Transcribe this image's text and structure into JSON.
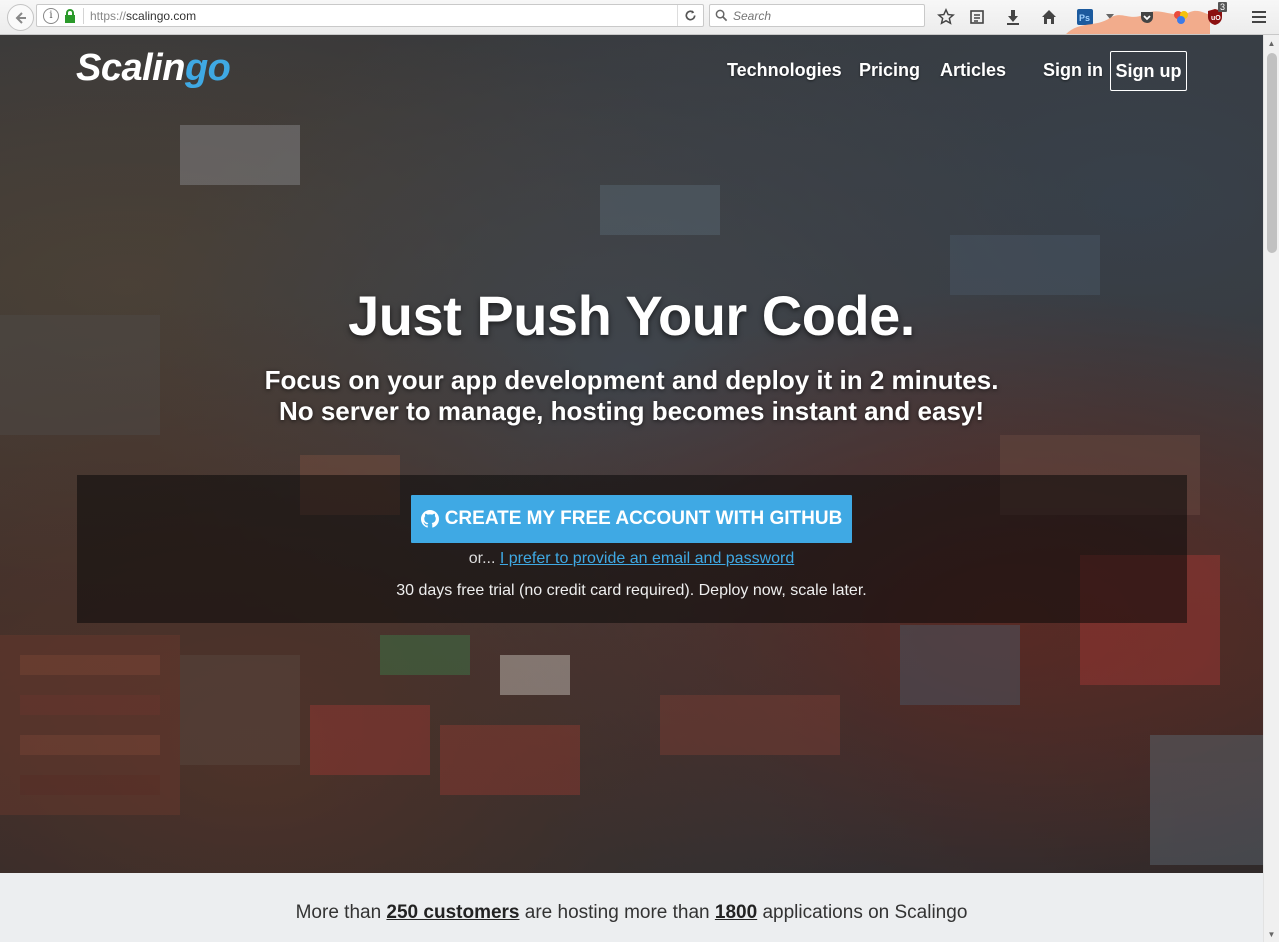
{
  "browser": {
    "url_scheme": "https://",
    "url_host": "scalingo.com",
    "search_placeholder": "Search",
    "badge_count": "3"
  },
  "site": {
    "logo_main": "Scalin",
    "logo_accent": "go",
    "accent_color": "#3fa9e4"
  },
  "nav": {
    "technologies": "Technologies",
    "pricing": "Pricing",
    "articles": "Articles",
    "sign_in": "Sign in",
    "sign_up": "Sign up"
  },
  "hero": {
    "headline": "Just Push Your Code.",
    "tagline_1": "Focus on your app development and deploy it in 2 minutes.",
    "tagline_2": "No server to manage, hosting becomes instant and easy!",
    "github_button": "CREATE MY FREE ACCOUNT WITH GITHUB",
    "alt_prefix": "or...",
    "alt_link": "I prefer to provide an email and password",
    "trial": "30 days free trial (no credit card required). Deploy now, scale later."
  },
  "stats": {
    "prefix": "More than",
    "customers": "250 customers",
    "middle": "are hosting more than",
    "apps": "1800",
    "suffix": "applications on Scalingo"
  }
}
